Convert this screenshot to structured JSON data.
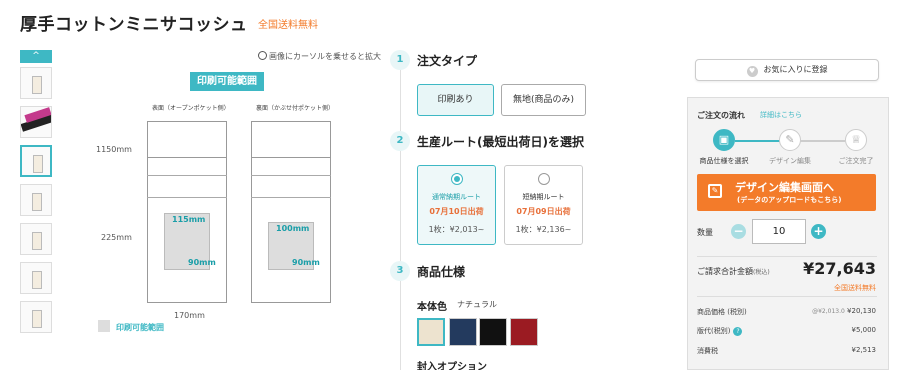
{
  "header": {
    "title": "厚手コットンミニサコッシュ",
    "badge": "全国送料無料"
  },
  "gallery": {
    "up_arrow": "^",
    "zoom_hint": "画像にカーソルを乗せると拡大",
    "print_area_button": "印刷可能範囲",
    "front_label": "表面（オープンポケット側）",
    "back_label": "裏面（かぶせ付ポケット側）",
    "height_total": "1150mm",
    "height_body": "225mm",
    "width_body": "170mm",
    "front_area_h": "115mm",
    "front_area_w": "90mm",
    "back_area_h": "100mm",
    "back_area_w": "90mm",
    "legend": "印刷可能範囲"
  },
  "step1": {
    "num": "1",
    "title": "注文タイプ",
    "options": [
      "印刷あり",
      "無地(商品のみ)"
    ]
  },
  "step2": {
    "num": "2",
    "title": "生産ルート(最短出荷日)を選択",
    "routes": [
      {
        "name": "通常納期ルート",
        "date": "07月10日出荷",
        "price": "1枚：¥2,013~"
      },
      {
        "name": "短納期ルート",
        "date": "07月09日出荷",
        "price": "1枚：¥2,136~"
      }
    ]
  },
  "step3": {
    "num": "3",
    "title": "商品仕様",
    "body_color_label": "本体色",
    "body_color_value": "ナチュラル",
    "swatches": [
      "#ede3cf",
      "#233a5e",
      "#111111",
      "#9b1b22"
    ],
    "enclose_label": "封入オプション"
  },
  "sidebar": {
    "favorite": "お気に入りに登録",
    "flow_title": "ご注文の流れ",
    "flow_link": "詳細はこちら",
    "flow_steps": [
      "商品仕様を選択",
      "デザイン編集",
      "ご注文完了"
    ],
    "design_button_l1": "デザイン編集画面へ",
    "design_button_l2": "(データのアップロードもこちら)",
    "qty_label": "数量",
    "qty_value": "10",
    "total_label": "ご請求合計金額",
    "total_tax": "(税込)",
    "total_value": "¥27,643",
    "shipping": "全国送料無料",
    "rows": [
      {
        "label": "商品価格 (税別)",
        "note": "@¥2,013.0",
        "value": "¥20,130"
      },
      {
        "label": "版代(税別)",
        "note": "",
        "value": "¥5,000"
      },
      {
        "label": "消費税",
        "note": "",
        "value": "¥2,513"
      }
    ]
  }
}
